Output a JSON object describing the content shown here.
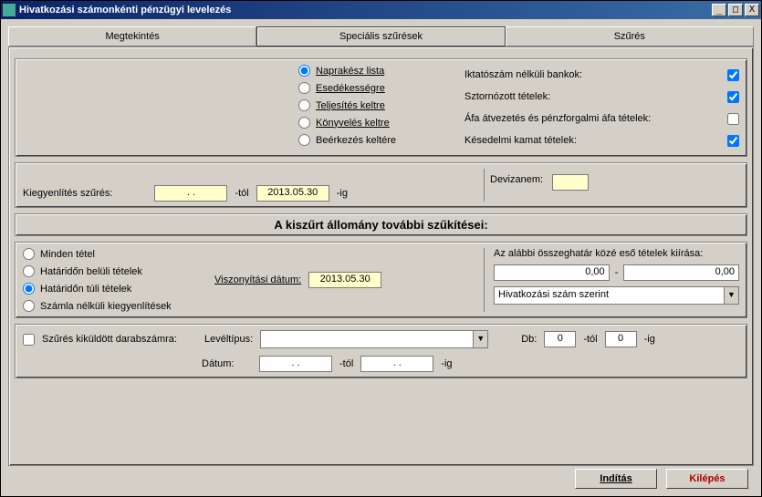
{
  "window": {
    "title": "Hivatkozási számonkénti pénzügyi levelezés"
  },
  "tabs": {
    "view": "Megtekintés",
    "special": "Speciális szűrések",
    "filter": "Szűrés"
  },
  "radios": {
    "r1": "Naprakész lista",
    "r2": "Esedékességre",
    "r3": "Teljesítés keltre",
    "r4": "Könyvelés keltre",
    "r5": "Beérkezés keltére"
  },
  "checks": {
    "c1": "Iktatószám nélküli bankok:",
    "c2": "Sztornózott tételek:",
    "c3": "Áfa átvezetés és pénzforgalmi áfa tételek:",
    "c4": "Késedelmi kamat tételek:"
  },
  "deviza_label": "Devizanem:",
  "kieg_label": "Kiegyenlítés szűrés:",
  "kieg_from": ". .",
  "kieg_to": "2013.05.30",
  "tol_label": "-tól",
  "ig_label": "-ig",
  "heading": "A kiszűrt állomány további szűkítései:",
  "radios2": {
    "r1": "Minden tétel",
    "r2": "Határidőn belüli tételek",
    "r3": "Határidőn túli tételek",
    "r4": "Számla nélküli kiegyenlítések"
  },
  "visz_label": "Viszonyítási dátum:",
  "visz_date": "2013.05.30",
  "range_label": "Az alábbi összeghatár közé eső tételek kiírása:",
  "range_from": "0,00",
  "range_sep": "-",
  "range_to": "0,00",
  "combo_value": "Hivatkozási szám szerint",
  "szures_chk": "Szűrés kiküldött darabszámra:",
  "leveltipus_label": "Levéltípus:",
  "db_label": "Db:",
  "db_from": "0",
  "db_to": "0",
  "datum_label": "Dátum:",
  "datum_from": ". .",
  "datum_to": ". .",
  "buttons": {
    "start": "Indítás",
    "exit": "Kilépés"
  }
}
